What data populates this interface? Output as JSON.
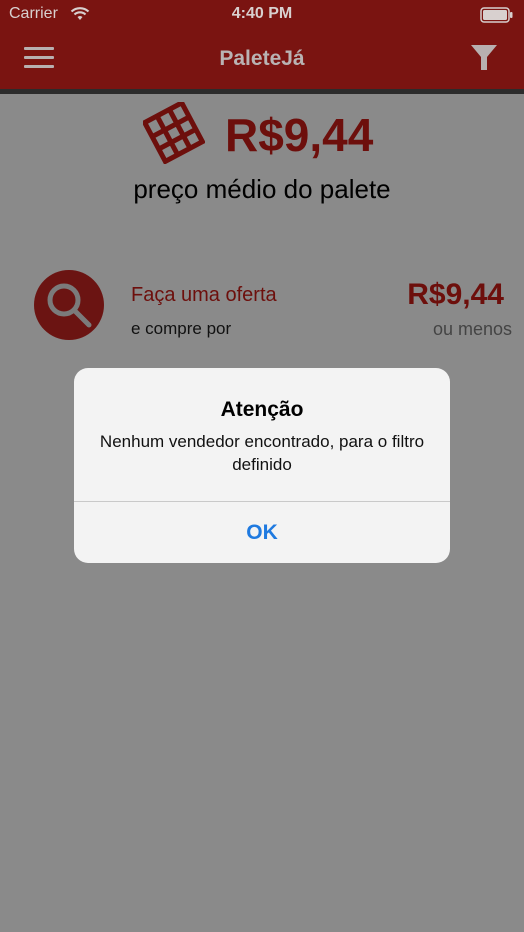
{
  "status_bar": {
    "carrier": "Carrier",
    "time": "4:40 PM"
  },
  "navbar": {
    "title": "PaleteJá",
    "menu_icon": "hamburger-icon",
    "filter_icon": "filter-icon"
  },
  "summary": {
    "price": "R$9,44",
    "caption": "preço médio do palete",
    "icon": "pallet-icon"
  },
  "offer": {
    "title": "Faça uma oferta",
    "subtitle": "e compre por",
    "price": "R$9,44",
    "qualifier": "ou menos",
    "icon": "search-icon"
  },
  "alert": {
    "title": "Atenção",
    "message": "Nenhum vendedor encontrado, para o filtro definido",
    "ok_label": "OK"
  },
  "colors": {
    "brand": "#7a1411",
    "accent_text": "#6d0f0c",
    "overlay": "#8a8a8a",
    "ios_blue": "#1f7ae0"
  }
}
